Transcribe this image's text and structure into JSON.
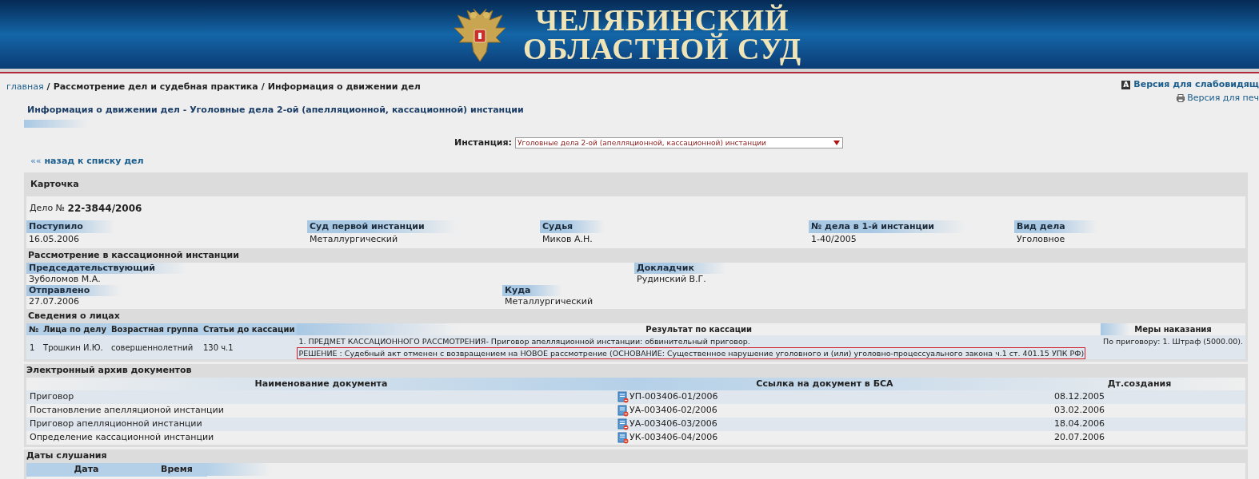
{
  "header": {
    "title_lines": [
      "ЧЕЛЯБИНСКИЙ",
      "ОБЛАСТНОЙ СУД"
    ]
  },
  "breadcrumbs": [
    {
      "kind": "link",
      "text": "главная"
    },
    {
      "kind": "sep",
      "text": "/"
    },
    {
      "kind": "item",
      "text": "Рассмотрение дел и судебная практика"
    },
    {
      "kind": "sep",
      "text": "/"
    },
    {
      "kind": "item",
      "text": "Информация о движении дел"
    }
  ],
  "version_links": [
    {
      "kind": "low_vision",
      "badge": "A",
      "text": "Версия для слабовидящ"
    },
    {
      "kind": "print",
      "text": "Версия для печ"
    }
  ],
  "page_title": "Информация о движении дел - Уголовные дела 2-ой (апелляционной, кассационной) инстанции",
  "instance": {
    "label": "Инстанция:",
    "value": "Уголовные дела 2-ой (апелляционной, кассационной) инстанции"
  },
  "back_link": {
    "arrows": "««",
    "text": "назад к списку дел"
  },
  "card": {
    "title": "Карточка",
    "case_label": "Дело №",
    "case_number": "22-3844/2006",
    "fields": [
      {
        "label": "Поступило",
        "value": "16.05.2006"
      },
      {
        "label": "Суд первой инстанции",
        "value": "Металлургический"
      },
      {
        "label": "Судья",
        "value": "Миков А.Н."
      },
      {
        "label": "№ дела в 1-й инстанции",
        "value": "1-40/2005"
      },
      {
        "label": "Вид дела",
        "value": "Уголовное"
      }
    ]
  },
  "cassation": {
    "title": "Рассмотрение в кассационной инстанции",
    "row_1": [
      {
        "label": "Председательствующий",
        "value": "Зуболомов М.А."
      },
      {
        "label": "Докладчик",
        "value": "Рудинский В.Г."
      }
    ],
    "row_2": [
      {
        "label": "Отправлено",
        "value": "27.07.2006"
      },
      {
        "label": "Куда",
        "value": "Металлургический"
      }
    ]
  },
  "persons": {
    "title": "Сведения о лицах",
    "columns": [
      "№",
      "Лица по делу",
      "Возрастная группа",
      "Статьи до кассации",
      "Результат по кассации",
      "Меры наказания"
    ],
    "rows": [
      {
        "number": "1",
        "name": "Трошкин И.Ю.",
        "age_group": "совершеннолетний",
        "articles": "130 ч.1",
        "result_lines": [
          {
            "text": "1. ПРЕДМЕТ КАССАЦИОННОГО РАССМОТРЕНИЯ- Приговор апелляционной инстанции: обвинительный приговор.",
            "highlighted": false
          },
          {
            "text": "РЕШЕНИЕ : Судебный акт отменен с возвращением на НОВОЕ рассмотрение (ОСНОВАНИЕ: Существенное нарушение уголовного и (или) уголовно-процессуального закона ч.1 ст. 401.15 УПК РФ)",
            "highlighted": true
          }
        ],
        "punishment": "По приговору: 1. Штраф (5000.00)."
      }
    ]
  },
  "archive": {
    "title": "Электронный архив документов",
    "columns": [
      "Наименование документа",
      "Ссылка на документ в БСА",
      "Дт.создания"
    ],
    "rows": [
      {
        "name": "Приговор",
        "link": "УП-003406-01/2006",
        "date": "08.12.2005"
      },
      {
        "name": "Постановление апелляционой инстанции",
        "link": "УА-003406-02/2006",
        "date": "03.02.2006"
      },
      {
        "name": "Приговор апелляционной инстанции",
        "link": "УА-003406-03/2006",
        "date": "18.04.2006"
      },
      {
        "name": "Определение кассационной инстанции",
        "link": "УК-003406-04/2006",
        "date": "20.07.2006"
      }
    ]
  },
  "hearings": {
    "title": "Даты слушания",
    "columns": [
      "Дата",
      "Время"
    ]
  }
}
